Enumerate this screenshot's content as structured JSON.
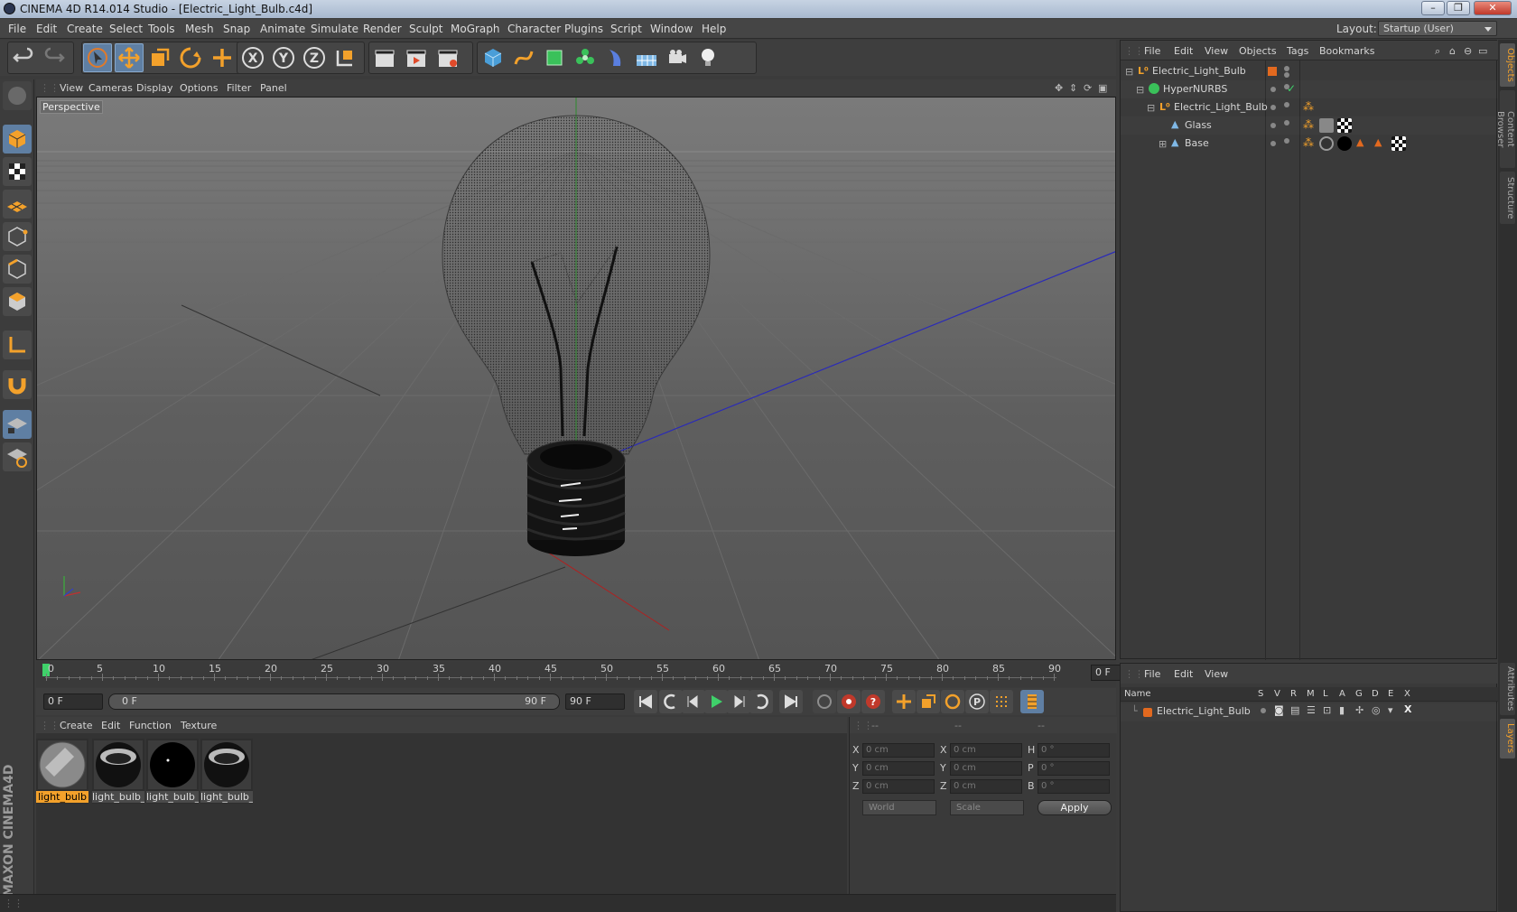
{
  "window": {
    "title": "CINEMA 4D R14.014 Studio - [Electric_Light_Bulb.c4d]"
  },
  "menubar": {
    "items": [
      "File",
      "Edit",
      "Create",
      "Select",
      "Tools",
      "Mesh",
      "Snap",
      "Animate",
      "Simulate",
      "Render",
      "Sculpt",
      "MoGraph",
      "Character",
      "Plugins",
      "Script",
      "Window",
      "Help"
    ],
    "layout_label": "Layout:",
    "layout_value": "Startup (User)"
  },
  "viewport": {
    "menu": [
      "View",
      "Cameras",
      "Display",
      "Options",
      "Filter",
      "Panel"
    ],
    "camera_label": "Perspective"
  },
  "timeline": {
    "ticks": [
      "0",
      "5",
      "10",
      "15",
      "20",
      "25",
      "30",
      "35",
      "40",
      "45",
      "50",
      "55",
      "60",
      "65",
      "70",
      "75",
      "80",
      "85",
      "90"
    ],
    "current_frame": "0 F"
  },
  "transport": {
    "start_field": "0 F",
    "range_start": "0 F",
    "range_end": "90 F",
    "end_field": "90 F"
  },
  "materials": {
    "menu": [
      "Create",
      "Edit",
      "Function",
      "Texture"
    ],
    "items": [
      {
        "label": "light_bulb",
        "active": true
      },
      {
        "label": "light_bulb_",
        "active": false
      },
      {
        "label": "light_bulb_",
        "active": false
      },
      {
        "label": "light_bulb_",
        "active": false
      }
    ]
  },
  "coordinates": {
    "headers": [
      "--",
      "--",
      "--"
    ],
    "rows": [
      {
        "a": "X",
        "av": "0 cm",
        "b": "X",
        "bv": "0 cm",
        "c": "H",
        "cv": "0 °"
      },
      {
        "a": "Y",
        "av": "0 cm",
        "b": "Y",
        "bv": "0 cm",
        "c": "P",
        "cv": "0 °"
      },
      {
        "a": "Z",
        "av": "0 cm",
        "b": "Z",
        "bv": "0 cm",
        "c": "B",
        "cv": "0 °"
      }
    ],
    "mode_world": "World",
    "mode_scale": "Scale",
    "apply": "Apply"
  },
  "objects": {
    "menu": [
      "File",
      "Edit",
      "View",
      "Objects",
      "Tags",
      "Bookmarks"
    ],
    "rows": [
      {
        "name": "Electric_Light_Bulb",
        "indent": 0
      },
      {
        "name": "HyperNURBS",
        "indent": 1
      },
      {
        "name": "Electric_Light_Bulb",
        "indent": 2
      },
      {
        "name": "Glass",
        "indent": 3
      },
      {
        "name": "Base",
        "indent": 3
      }
    ]
  },
  "layers": {
    "menu": [
      "File",
      "Edit",
      "View"
    ],
    "columns": [
      "Name",
      "S",
      "V",
      "R",
      "M",
      "L",
      "A",
      "G",
      "D",
      "E",
      "X"
    ],
    "rows": [
      {
        "name": "Electric_Light_Bulb"
      }
    ]
  },
  "right_tabs": [
    "Objects",
    "Content Browser",
    "Structure",
    "Attributes",
    "Layers"
  ],
  "colors": {
    "accent": "#f3a12b",
    "selection": "#5f7fa3",
    "layer_color": "#e2691f"
  }
}
